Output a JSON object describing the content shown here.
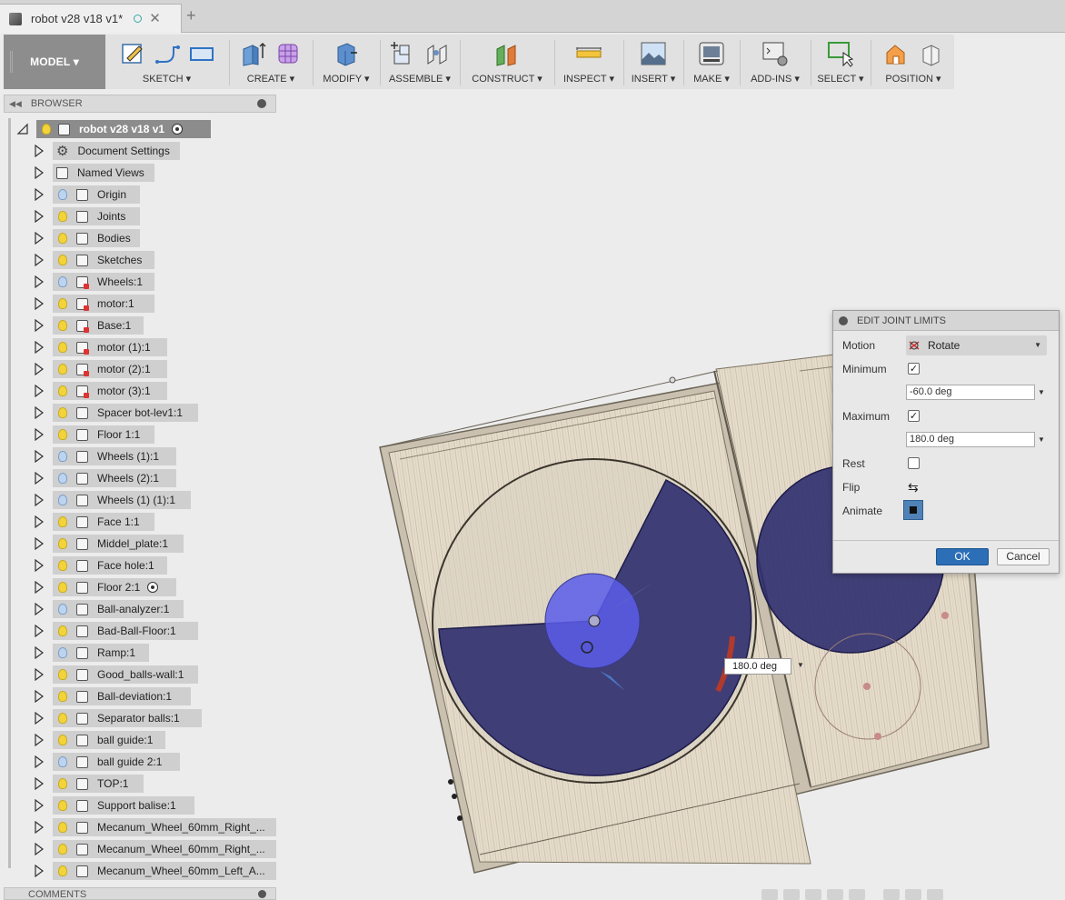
{
  "tab": {
    "title": "robot v28 v18 v1*",
    "add": "+"
  },
  "toolbar": {
    "workspace": "MODEL ▾",
    "groups": [
      {
        "label": "SKETCH ▾"
      },
      {
        "label": "CREATE ▾"
      },
      {
        "label": "MODIFY ▾"
      },
      {
        "label": "ASSEMBLE ▾"
      },
      {
        "label": "CONSTRUCT ▾"
      },
      {
        "label": "INSPECT ▾"
      },
      {
        "label": "INSERT ▾"
      },
      {
        "label": "MAKE ▾"
      },
      {
        "label": "ADD-INS ▾"
      },
      {
        "label": "SELECT ▾"
      },
      {
        "label": "POSITION ▾"
      }
    ]
  },
  "browser": {
    "title": "BROWSER",
    "root": "robot v28 v18 v1",
    "items": [
      {
        "label": "Document Settings"
      },
      {
        "label": "Named Views"
      },
      {
        "label": "Origin"
      },
      {
        "label": "Joints"
      },
      {
        "label": "Bodies"
      },
      {
        "label": "Sketches"
      },
      {
        "label": "Wheels:1"
      },
      {
        "label": "motor:1"
      },
      {
        "label": "Base:1"
      },
      {
        "label": "motor (1):1"
      },
      {
        "label": "motor (2):1"
      },
      {
        "label": "motor (3):1"
      },
      {
        "label": "Spacer bot-lev1:1"
      },
      {
        "label": "Floor 1:1"
      },
      {
        "label": "Wheels (1):1"
      },
      {
        "label": "Wheels (2):1"
      },
      {
        "label": "Wheels (1) (1):1"
      },
      {
        "label": "Face 1:1"
      },
      {
        "label": "Middel_plate:1"
      },
      {
        "label": "Face hole:1"
      },
      {
        "label": "Floor 2:1"
      },
      {
        "label": "Ball-analyzer:1"
      },
      {
        "label": "Bad-Ball-Floor:1"
      },
      {
        "label": "Ramp:1"
      },
      {
        "label": "Good_balls-wall:1"
      },
      {
        "label": "Ball-deviation:1"
      },
      {
        "label": "Separator balls:1"
      },
      {
        "label": "ball guide:1"
      },
      {
        "label": "ball guide 2:1"
      },
      {
        "label": "TOP:1"
      },
      {
        "label": "Support balise:1"
      },
      {
        "label": "Mecanum_Wheel_60mm_Right_..."
      },
      {
        "label": "Mecanum_Wheel_60mm_Right_..."
      },
      {
        "label": "Mecanum_Wheel_60mm_Left_A..."
      }
    ],
    "comments": "COMMENTS"
  },
  "dialog": {
    "title": "EDIT JOINT LIMITS",
    "motion_label": "Motion",
    "motion_value": "Rotate",
    "minimum_label": "Minimum",
    "minimum_checked": "✓",
    "minimum_value": "-60.0 deg",
    "maximum_label": "Maximum",
    "maximum_checked": "✓",
    "maximum_value": "180.0 deg",
    "rest_label": "Rest",
    "flip_label": "Flip",
    "animate_label": "Animate",
    "ok": "OK",
    "cancel": "Cancel"
  },
  "viewport": {
    "angle_value": "180.0 deg"
  }
}
